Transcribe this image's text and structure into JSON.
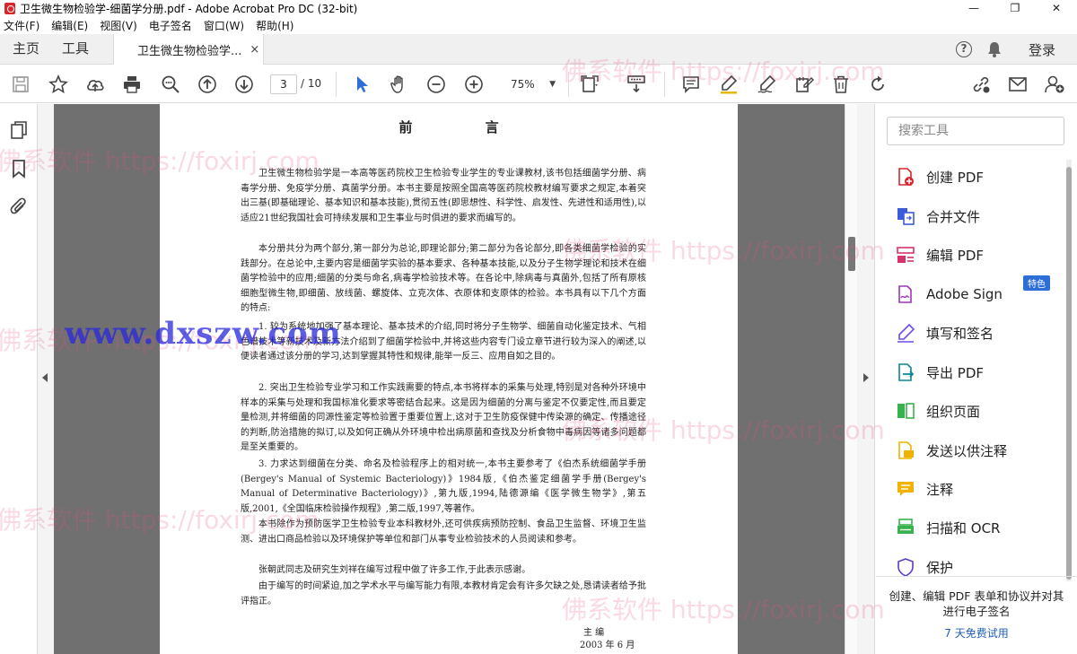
{
  "window": {
    "title": "卫生微生物检验学-细菌学分册.pdf - Adobe Acrobat Pro DC (32-bit)",
    "controls": [
      "—",
      "❐",
      "✕"
    ]
  },
  "menu": [
    "文件(F)",
    "编辑(E)",
    "视图(V)",
    "电子签名",
    "窗口(W)",
    "帮助(H)"
  ],
  "tabs": {
    "home": "主页",
    "tools": "工具",
    "document": "卫生微生物检验学...",
    "close": "×",
    "login": "登录",
    "help": "?"
  },
  "toolbar": {
    "page_current": "3",
    "page_total": "/ 10",
    "zoom": "75%"
  },
  "document": {
    "title": "前 言",
    "paragraphs": [
      "卫生微生物检验学是一本高等医药院校卫生检验专业学生的专业课教材,该书包括细菌学分册、病毒学分册、免疫学分册、真菌学分册。本书主要是按照全国高等医药院校教材编写要求之规定,本着突出三基(即基础理论、基本知识和基本技能),贯彻五性(即思想性、科学性、启发性、先进性和适用性),以适应21世纪我国社会可持续发展和卫生事业与时俱进的要求而编写的。",
      "本分册共分为两个部分,第一部分为总论,即理论部分;第二部分为各论部分,即各类细菌学检验的实践部分。在总论中,主要内容是细菌学实验的基本要求、各种基本技能,以及分子生物学理论和技术在细菌学检验中的应用;细菌的分类与命名,病毒学检验技术等。在各论中,除病毒与真菌外,包括了所有原核细胞型微生物,即细菌、放线菌、螺旋体、立克次体、衣原体和支原体的检验。本书具有以下几个方面的特点:",
      "1. 较为系统地加强了基本理论、基本技术的介绍,同时将分子生物学、细菌自动化鉴定技术、气相色谱技术等新技术及新方法介绍到了细菌学检验中,并将这些内容专门设立章节进行较为深入的阐述,以便读者通过该分册的学习,达到掌握其特性和规律,能举一反三、应用自如之目的。",
      "2. 突出卫生检验专业学习和工作实践需要的特点,本书将样本的采集与处理,特别是对各种外环境中样本的采集与处理和我国标准化要求等密结合起来。这是因为细菌的分离与鉴定不仅要定性,而且要定量检测,并将细菌的同源性鉴定等检验置于重要位置上,这对于卫生防疫保健中传染源的确定、传播途径的判断,防治措施的拟订,以及如何正确从外环境中检出病原菌和查找及分析食物中毒病因等诸多问题都是至关重要的。",
      "3. 力求达到细菌在分类、命名及检验程序上的相对统一,本书主要参考了《伯杰系统细菌学手册(Bergey's Manual of Systemic Bacteriology)》1984版,《伯杰鉴定细菌学手册(Bergey's Manual of Determinative Bacteriology)》,第九版,1994,陆德源编《医学微生物学》,第五版,2001,《全国临床检验操作规程》,第二版,1997,等著作。",
      "本书除作为预防医学卫生检验专业本科教材外,还可供疾病预防控制、食品卫生监督、环境卫生监测、进出口商品检验以及环境保护等单位和部门从事专业检验技术的人员阅读和参考。",
      "张朝武同志及研究生刘祥在编写过程中做了许多工作,于此表示感谢。",
      "由于编写的时间紧迫,加之学术水平与编写能力有限,本教材肯定会有许多欠缺之处,恳请读者给予批评指正。"
    ],
    "signature": {
      "editor": "主 编",
      "date": "2003 年 6 月"
    }
  },
  "tools_panel": {
    "search_placeholder": "搜索工具",
    "items": [
      {
        "label": "创建 PDF",
        "icon": "create-pdf-icon",
        "color": "#d9262b"
      },
      {
        "label": "合并文件",
        "icon": "combine-files-icon",
        "color": "#3b5bdb"
      },
      {
        "label": "编辑 PDF",
        "icon": "edit-pdf-icon",
        "color": "#d6336c"
      },
      {
        "label": "Adobe Sign",
        "icon": "adobe-sign-icon",
        "color": "#9c36b5"
      },
      {
        "label": "填写和签名",
        "icon": "fill-sign-icon",
        "color": "#7048e8"
      },
      {
        "label": "导出 PDF",
        "icon": "export-pdf-icon",
        "color": "#0c8599"
      },
      {
        "label": "组织页面",
        "icon": "organize-pages-icon",
        "color": "#37b24d"
      },
      {
        "label": "发送以供注释",
        "icon": "send-comments-icon",
        "color": "#f0b400"
      },
      {
        "label": "注释",
        "icon": "comment-icon",
        "color": "#f0b400"
      },
      {
        "label": "扫描和 OCR",
        "icon": "scan-ocr-icon",
        "color": "#37b24d"
      },
      {
        "label": "保护",
        "icon": "protect-icon",
        "color": "#5f3dc4"
      }
    ],
    "badge": "特色",
    "promo_text": "创建、编辑 PDF 表单和协议并对其进行电子签名",
    "promo_link": "7 天免费试用"
  },
  "watermarks": {
    "foxirj": "佛系软件 https://foxirj.com",
    "dxszw": "www.dxszw.com"
  }
}
